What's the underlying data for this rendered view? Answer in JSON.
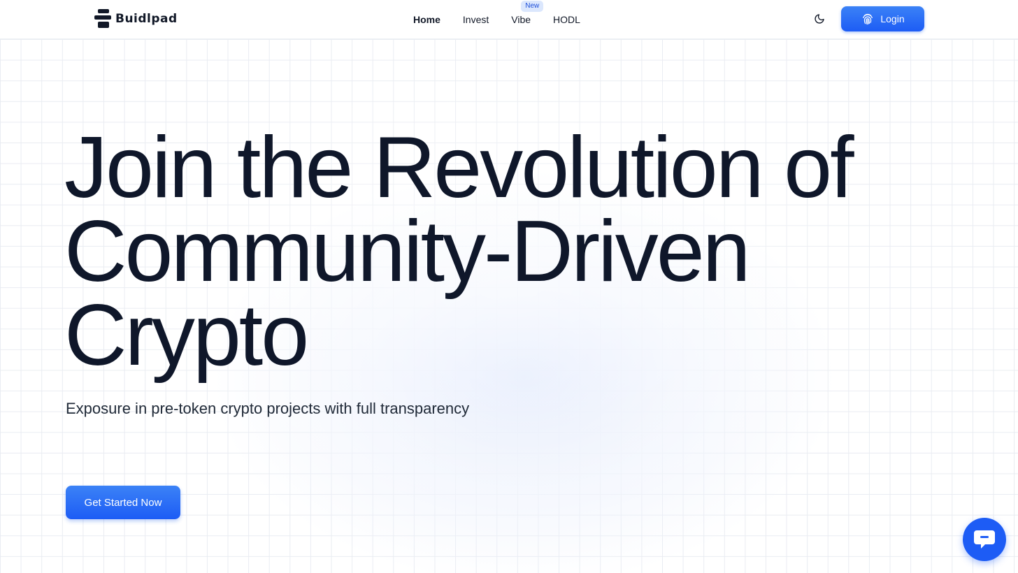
{
  "brand": {
    "name": "Buidlpad"
  },
  "nav": {
    "items": [
      {
        "label": "Home",
        "active": true
      },
      {
        "label": "Invest"
      },
      {
        "label": "Vibe",
        "badge": "New"
      },
      {
        "label": "HODL"
      }
    ]
  },
  "header": {
    "theme_icon": "moon-icon",
    "login_label": "Login",
    "login_icon": "fingerprint-icon"
  },
  "hero": {
    "title_lines": [
      "Join the Revolution of",
      "Community-Driven",
      "Crypto"
    ],
    "subtitle": "Exposure in pre-token crypto projects with full transparency",
    "cta_label": "Get Started Now"
  },
  "chat": {
    "icon": "chat-bubble-icon"
  },
  "colors": {
    "accent": "#1d5cf5",
    "text": "#0f172a",
    "badge_bg": "#dbe7fd"
  }
}
